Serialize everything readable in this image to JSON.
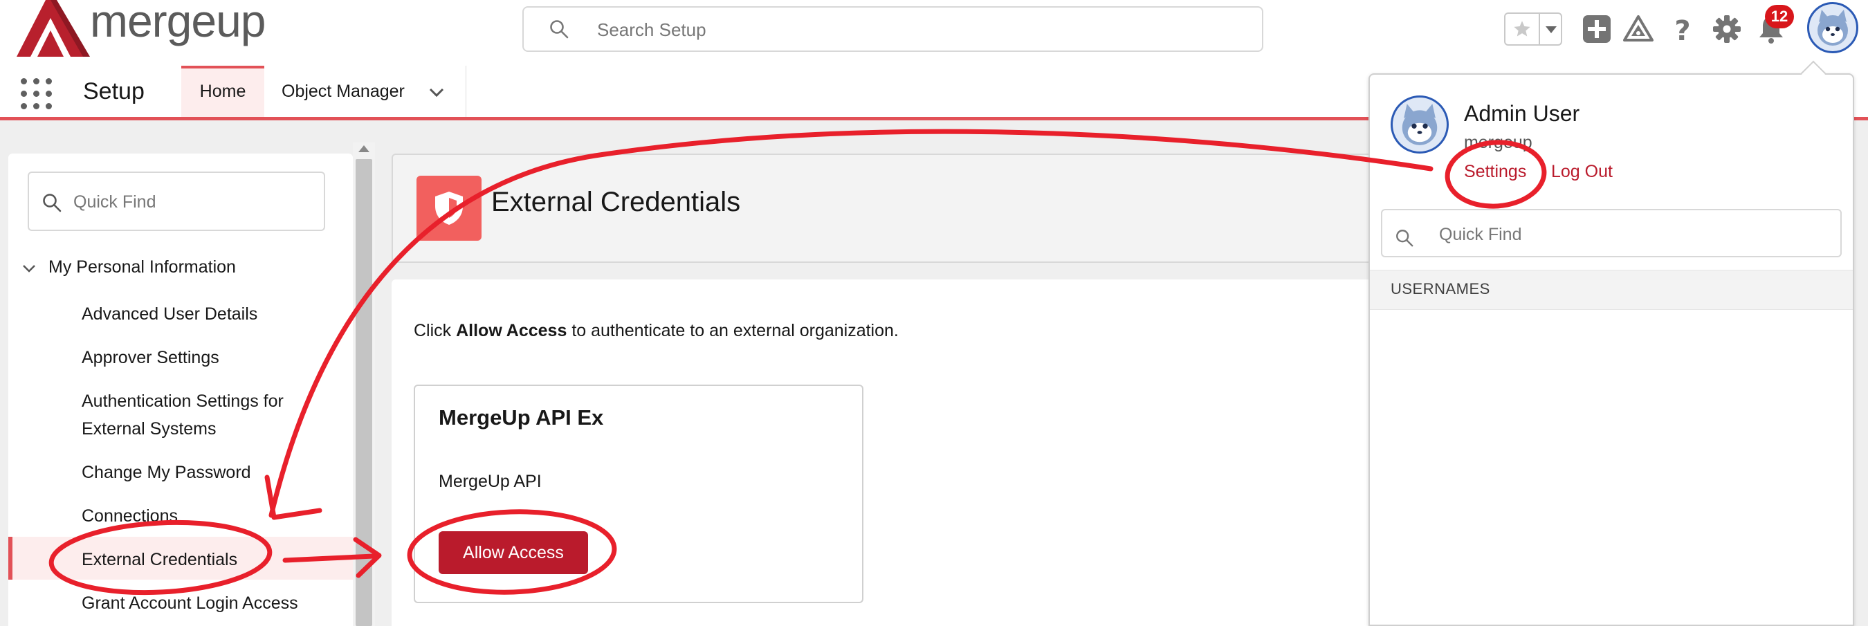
{
  "header": {
    "logo_text": "mergeup",
    "search_placeholder": "Search Setup",
    "notification_count": "12",
    "icons": [
      "star-icon",
      "chevron-down-icon",
      "add-icon",
      "trailhead-icon",
      "help-icon",
      "gear-icon",
      "bell-icon",
      "avatar"
    ]
  },
  "nav": {
    "app_name": "Setup",
    "tabs": [
      {
        "label": "Home",
        "active": true
      },
      {
        "label": "Object Manager",
        "has_dropdown": true
      }
    ]
  },
  "sidebar": {
    "quick_find_placeholder": "Quick Find",
    "section": "My Personal Information",
    "items": [
      {
        "label": "Advanced User Details"
      },
      {
        "label": "Approver Settings"
      },
      {
        "label": "Authentication Settings for",
        "label2": "External Systems"
      },
      {
        "label": "Change My Password"
      },
      {
        "label": "Connections"
      },
      {
        "label": "External Credentials",
        "selected": true
      },
      {
        "label": "Grant Account Login Access"
      }
    ]
  },
  "page": {
    "title": "External Credentials",
    "instruction_pre": "Click ",
    "instruction_bold": "Allow Access",
    "instruction_post": " to authenticate to an external organization.",
    "card": {
      "title": "MergeUp API Ex",
      "subtitle": "MergeUp API",
      "button": "Allow Access"
    }
  },
  "user_panel": {
    "name": "Admin User",
    "org": "mergeup",
    "settings_link": "Settings",
    "logout_link": "Log Out",
    "search_placeholder": "Quick Find",
    "section_label": "USERNAMES"
  },
  "colors": {
    "brand_red": "#ba1b2c",
    "accent_coral": "#e25157",
    "annotation_red": "#e8202b",
    "avatar_blue": "#2b5ab5"
  }
}
